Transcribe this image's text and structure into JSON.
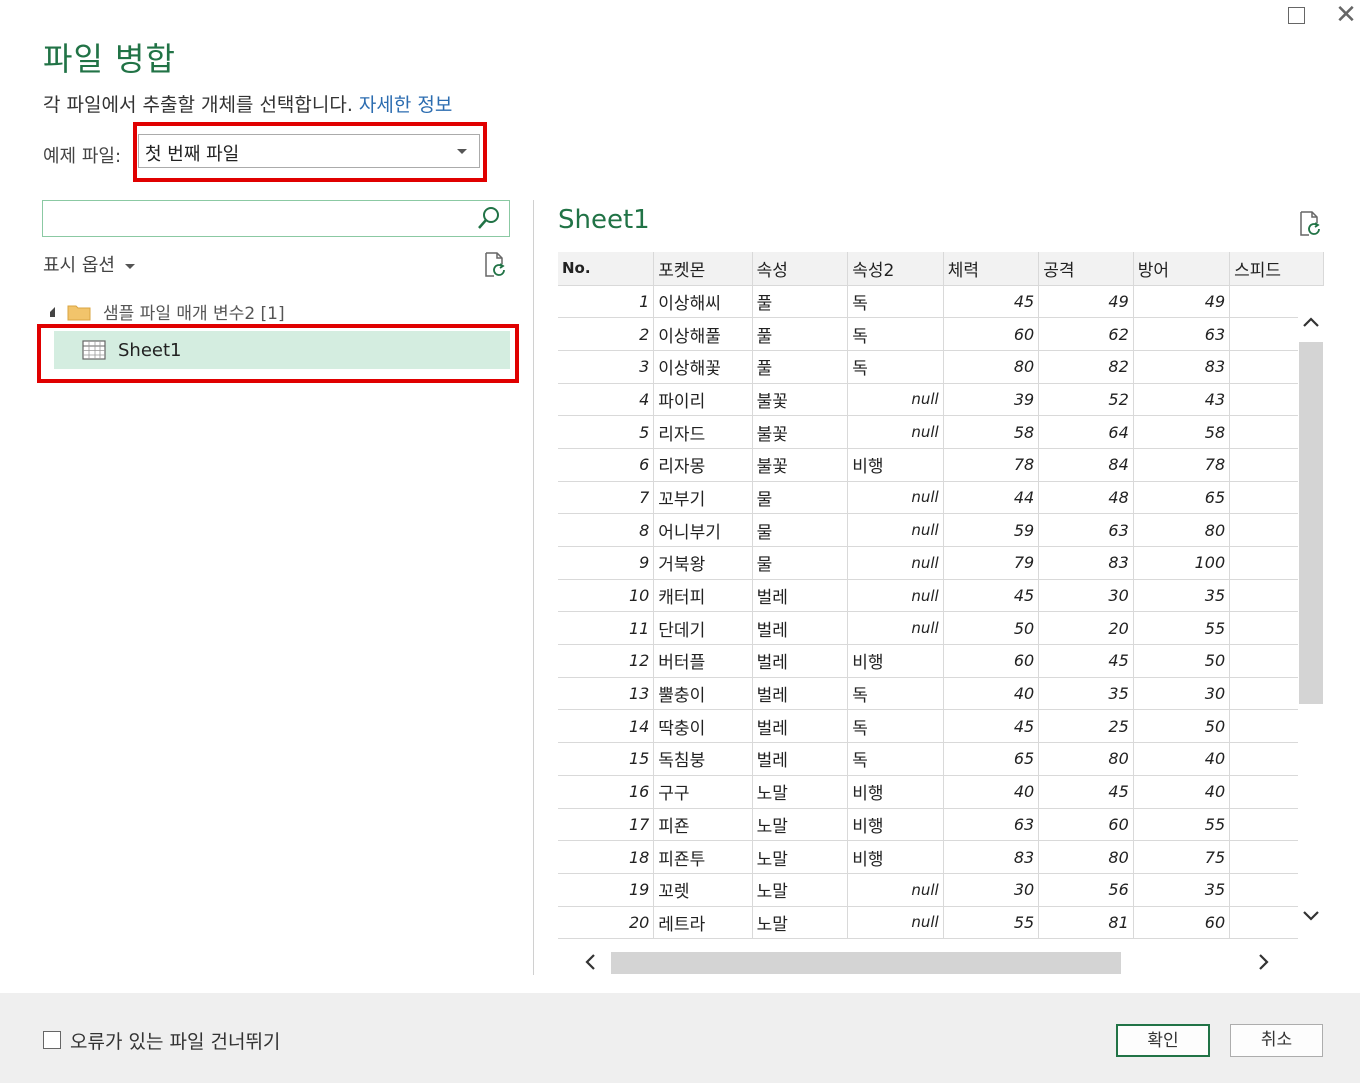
{
  "dialog": {
    "title": "파일 병합",
    "description": "각 파일에서 추출할 개체를 선택합니다.",
    "learn_more": "자세한 정보"
  },
  "example_file": {
    "label": "예제 파일:",
    "selected": "첫 번째 파일"
  },
  "search": {
    "placeholder": ""
  },
  "display_options": "표시 옵션",
  "tree": {
    "folder_label": "샘플 파일 매개 변수2 [1]",
    "sheet_label": "Sheet1"
  },
  "preview": {
    "title": "Sheet1",
    "columns": [
      "No.",
      "포켓몬",
      "속성",
      "속성2",
      "체력",
      "공격",
      "방어",
      "스피드"
    ],
    "rows": [
      [
        "1",
        "이상해씨",
        "풀",
        "독",
        "45",
        "49",
        "49"
      ],
      [
        "2",
        "이상해풀",
        "풀",
        "독",
        "60",
        "62",
        "63"
      ],
      [
        "3",
        "이상해꽃",
        "풀",
        "독",
        "80",
        "82",
        "83"
      ],
      [
        "4",
        "파이리",
        "불꽃",
        "null",
        "39",
        "52",
        "43"
      ],
      [
        "5",
        "리자드",
        "불꽃",
        "null",
        "58",
        "64",
        "58"
      ],
      [
        "6",
        "리자몽",
        "불꽃",
        "비행",
        "78",
        "84",
        "78"
      ],
      [
        "7",
        "꼬부기",
        "물",
        "null",
        "44",
        "48",
        "65"
      ],
      [
        "8",
        "어니부기",
        "물",
        "null",
        "59",
        "63",
        "80"
      ],
      [
        "9",
        "거북왕",
        "물",
        "null",
        "79",
        "83",
        "100"
      ],
      [
        "10",
        "캐터피",
        "벌레",
        "null",
        "45",
        "30",
        "35"
      ],
      [
        "11",
        "단데기",
        "벌레",
        "null",
        "50",
        "20",
        "55"
      ],
      [
        "12",
        "버터플",
        "벌레",
        "비행",
        "60",
        "45",
        "50"
      ],
      [
        "13",
        "뿔충이",
        "벌레",
        "독",
        "40",
        "35",
        "30"
      ],
      [
        "14",
        "딱충이",
        "벌레",
        "독",
        "45",
        "25",
        "50"
      ],
      [
        "15",
        "독침붕",
        "벌레",
        "독",
        "65",
        "80",
        "40"
      ],
      [
        "16",
        "구구",
        "노말",
        "비행",
        "40",
        "45",
        "40"
      ],
      [
        "17",
        "피죤",
        "노말",
        "비행",
        "63",
        "60",
        "55"
      ],
      [
        "18",
        "피죤투",
        "노말",
        "비행",
        "83",
        "80",
        "75"
      ],
      [
        "19",
        "꼬렛",
        "노말",
        "null",
        "30",
        "56",
        "35"
      ],
      [
        "20",
        "레트라",
        "노말",
        "null",
        "55",
        "81",
        "60"
      ]
    ]
  },
  "footer": {
    "skip_errors_label": "오류가 있는 파일 건너뛰기",
    "skip_errors_checked": false,
    "ok": "확인",
    "cancel": "취소"
  },
  "colors": {
    "accent": "#217346",
    "selected_row": "#d4ede0",
    "highlight_box": "#e00000",
    "link": "#2b6cb0"
  }
}
